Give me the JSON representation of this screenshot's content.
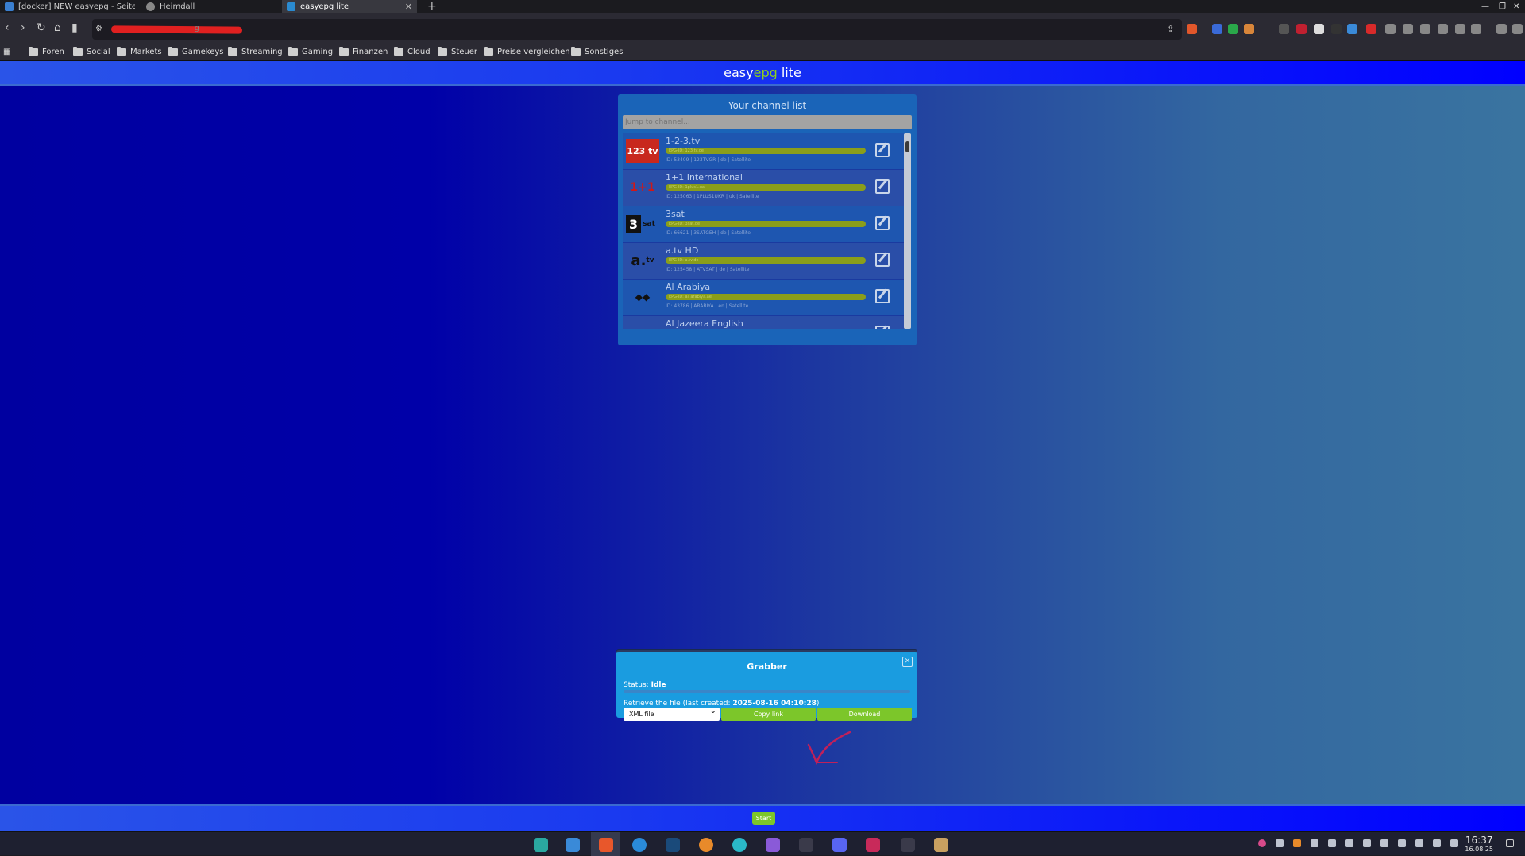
{
  "browser": {
    "tabs": [
      {
        "title": "[docker] NEW easyepg - Seite 20",
        "active": false
      },
      {
        "title": "Heimdall",
        "active": false
      },
      {
        "title": "easyepg lite",
        "active": true
      }
    ],
    "new_tab_icon": "plus-icon",
    "url_text": "g",
    "bookmarks": [
      "Foren",
      "Social",
      "Markets",
      "Gamekeys",
      "Streaming",
      "Gaming",
      "Finanzen",
      "Cloud",
      "Steuer",
      "Preise vergleichen",
      "Sonstiges"
    ]
  },
  "app": {
    "title_part1": "easy",
    "title_part2": "epg",
    "title_part3": " lite",
    "accent_color": "#8dd11b"
  },
  "channel_panel": {
    "title": "Your channel list",
    "search_placeholder": "Jump to channel...",
    "channels": [
      {
        "name": "1-2-3.tv",
        "epg": "EPG-ID: 123.tv.de",
        "meta": "ID: 53409 | 123TVGR | de | Satellite",
        "logo": "123tv"
      },
      {
        "name": "1+1 International",
        "epg": "EPG-ID: 1plus1.ua",
        "meta": "ID: 125063 | 1PLUS1UKR | uk | Satellite",
        "logo": "1+1"
      },
      {
        "name": "3sat",
        "epg": "EPG-ID: 3sat.de",
        "meta": "ID: 66621 | 3SATGEH | de | Satellite",
        "logo": "3sat"
      },
      {
        "name": "a.tv HD",
        "epg": "EPG-ID: a.tv.de",
        "meta": "ID: 125458 | ATVSAT | de | Satellite",
        "logo": "a.tv"
      },
      {
        "name": "Al Arabiya",
        "epg": "EPG-ID: al_arabiya.ae",
        "meta": "ID: 43786 | ARABIYA | en | Satellite",
        "logo": "arabiya"
      },
      {
        "name": "Al Jazeera English",
        "epg": "",
        "meta": "",
        "logo": "aljazeera"
      }
    ]
  },
  "grabber": {
    "title": "Grabber",
    "status_label": "Status:",
    "status_value": "Idle",
    "retrieve_label": "Retrieve the file (last created:",
    "retrieve_date": "2025-08-16 04:10:28",
    "retrieve_suffix": ")",
    "format_selected": "XML file",
    "copy_label": "Copy link",
    "download_label": "Download"
  },
  "footer": {
    "start_label": "Start"
  },
  "taskbar": {
    "time": "16:37",
    "date": "16.08.25"
  }
}
